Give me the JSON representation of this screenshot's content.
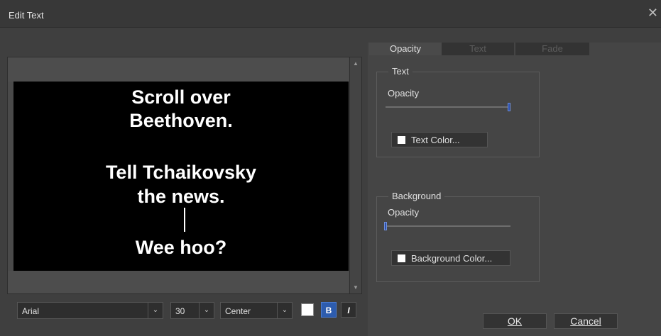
{
  "window": {
    "title": "Edit Text"
  },
  "preview": {
    "lines": [
      "Scroll over",
      "Beethoven.",
      "Tell Tchaikovsky",
      "the news.",
      "Wee hoo?"
    ]
  },
  "toolbar": {
    "font": "Arial",
    "size": "30",
    "alignment": "Center",
    "bold_label": "B",
    "italic_label": "I"
  },
  "tabs": [
    {
      "label": "Opacity",
      "active": true
    },
    {
      "label": "Text",
      "active": false
    },
    {
      "label": "Fade",
      "active": false
    }
  ],
  "text_group": {
    "title": "Text",
    "opacity_label": "Opacity",
    "opacity_value": 1.0,
    "color_button": "Text Color..."
  },
  "background_group": {
    "title": "Background",
    "opacity_label": "Opacity",
    "opacity_value": 0.0,
    "color_button": "Background Color..."
  },
  "buttons": {
    "ok": "OK",
    "cancel": "Cancel"
  },
  "colors": {
    "accent": "#2d5cae",
    "canvas": "#000000",
    "text": "#ffffff"
  }
}
